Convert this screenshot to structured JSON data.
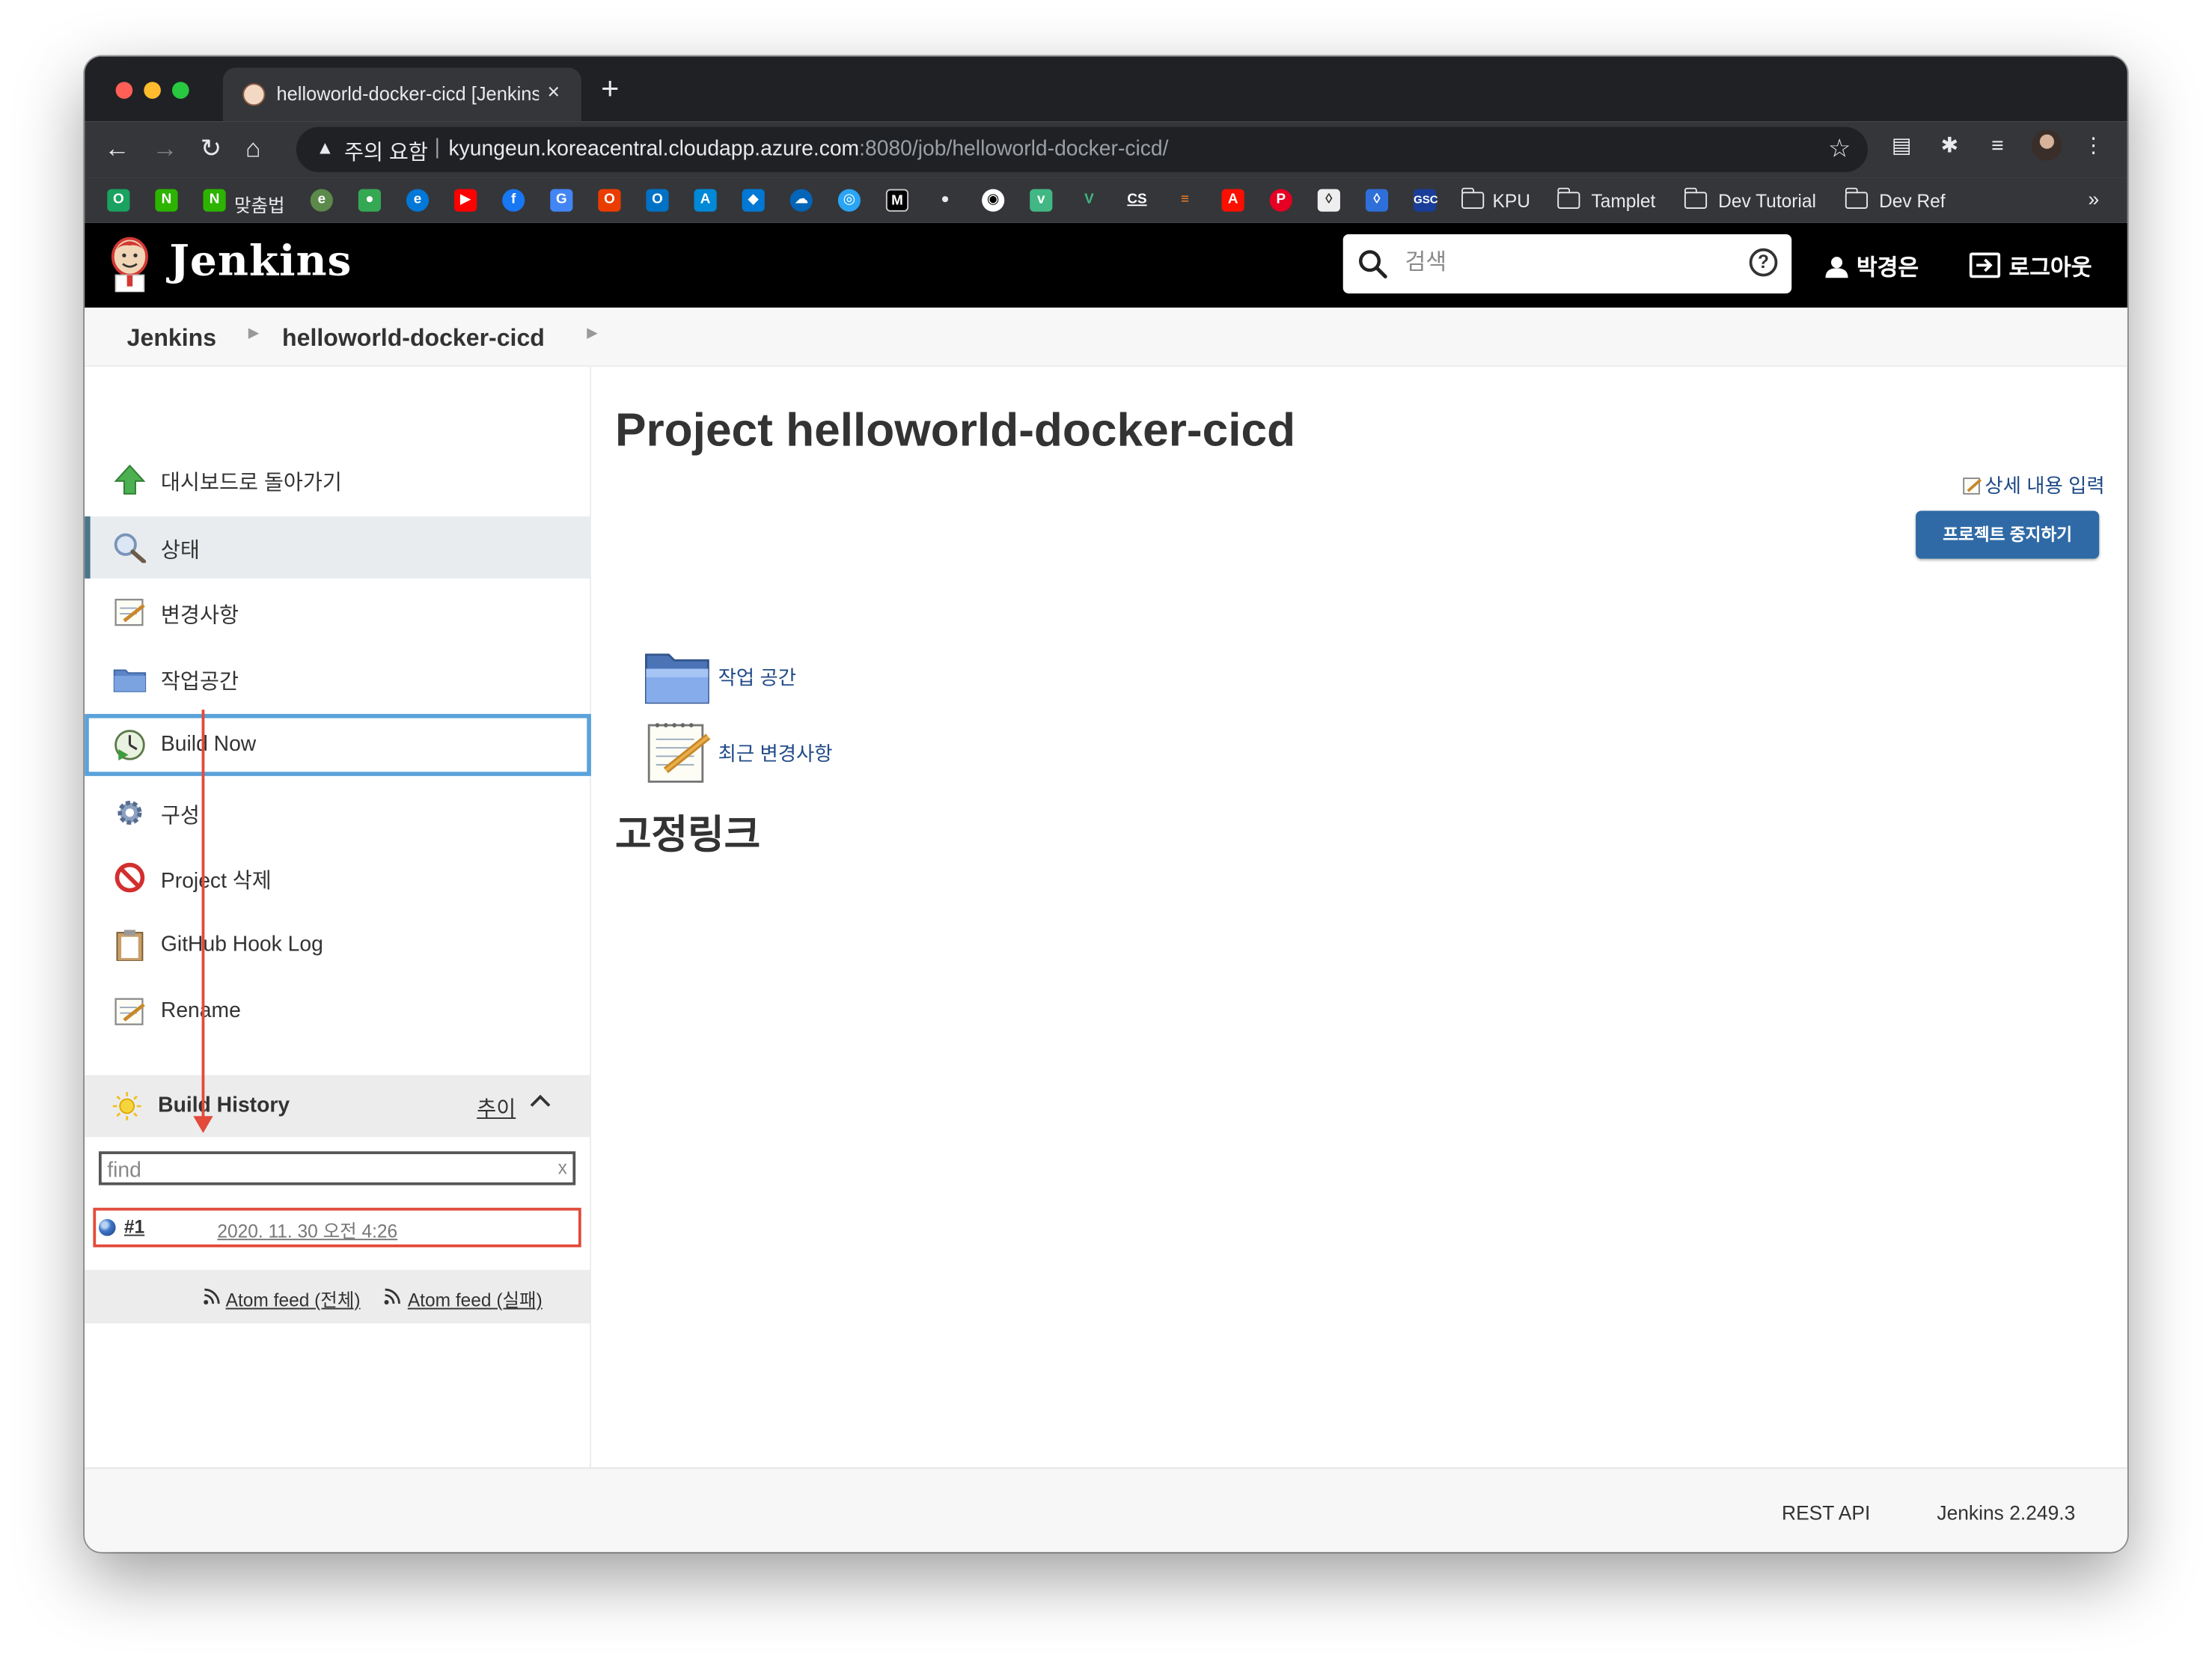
{
  "browser": {
    "tab_title": "helloworld-docker-cicd [Jenkins]",
    "tab_close": "×",
    "new_tab": "+",
    "omnibox": {
      "security_label": "주의 요함",
      "url_host": "kyungeun.koreacentral.cloudapp.azure.com",
      "url_path": ":8080/job/helloworld-docker-cicd/"
    },
    "bookmarks": {
      "items": [
        {
          "label": "맞춤법"
        },
        {
          "label": "KPU"
        },
        {
          "label": "Tamplet"
        },
        {
          "label": "Dev Tutorial"
        },
        {
          "label": "Dev Ref"
        }
      ],
      "more": "»"
    }
  },
  "jenkins": {
    "logo_text": "Jenkins",
    "search": {
      "placeholder": "검색"
    },
    "help_icon": "?",
    "user_name": "박경은",
    "logout_label": "로그아웃"
  },
  "breadcrumb": {
    "items": [
      "Jenkins",
      "helloworld-docker-cicd"
    ]
  },
  "sidepanel": {
    "tasks": [
      {
        "label": "대시보드로 돌아가기",
        "icon": "up-arrow-icon"
      },
      {
        "label": "상태",
        "icon": "magnifier-icon"
      },
      {
        "label": "변경사항",
        "icon": "notepad-icon"
      },
      {
        "label": "작업공간",
        "icon": "folder-icon"
      },
      {
        "label": "Build Now",
        "icon": "clock-icon"
      },
      {
        "label": "구성",
        "icon": "gear-icon"
      },
      {
        "label": "Project 삭제",
        "icon": "no-entry-icon"
      },
      {
        "label": "GitHub Hook Log",
        "icon": "clipboard-icon"
      },
      {
        "label": "Rename",
        "icon": "notepad-icon"
      }
    ],
    "build_history": {
      "title": "Build History",
      "trend_label": "추이",
      "find_placeholder": "find",
      "find_clear": "x",
      "builds": [
        {
          "number": "#1",
          "date": "2020. 11. 30 오전 4:26",
          "status": "success"
        }
      ],
      "feeds": [
        "Atom feed (전체)",
        "Atom feed (실패)"
      ]
    }
  },
  "main": {
    "title": "Project helloworld-docker-cicd",
    "edit_description": "상세 내용 입력",
    "disable_button": "프로젝트 중지하기",
    "links": [
      {
        "label": "작업 공간",
        "icon": "folder-icon"
      },
      {
        "label": "최근 변경사항",
        "icon": "notepad-icon"
      }
    ],
    "permalinks_heading": "고정링크"
  },
  "footer": {
    "rest_api": "REST API",
    "version": "Jenkins 2.249.3"
  },
  "colors": {
    "header_bg": "#000000",
    "link": "#204a87",
    "button": "#2f6aa6",
    "annotation": "#e24a3b",
    "focus_border": "#5aa2da"
  }
}
